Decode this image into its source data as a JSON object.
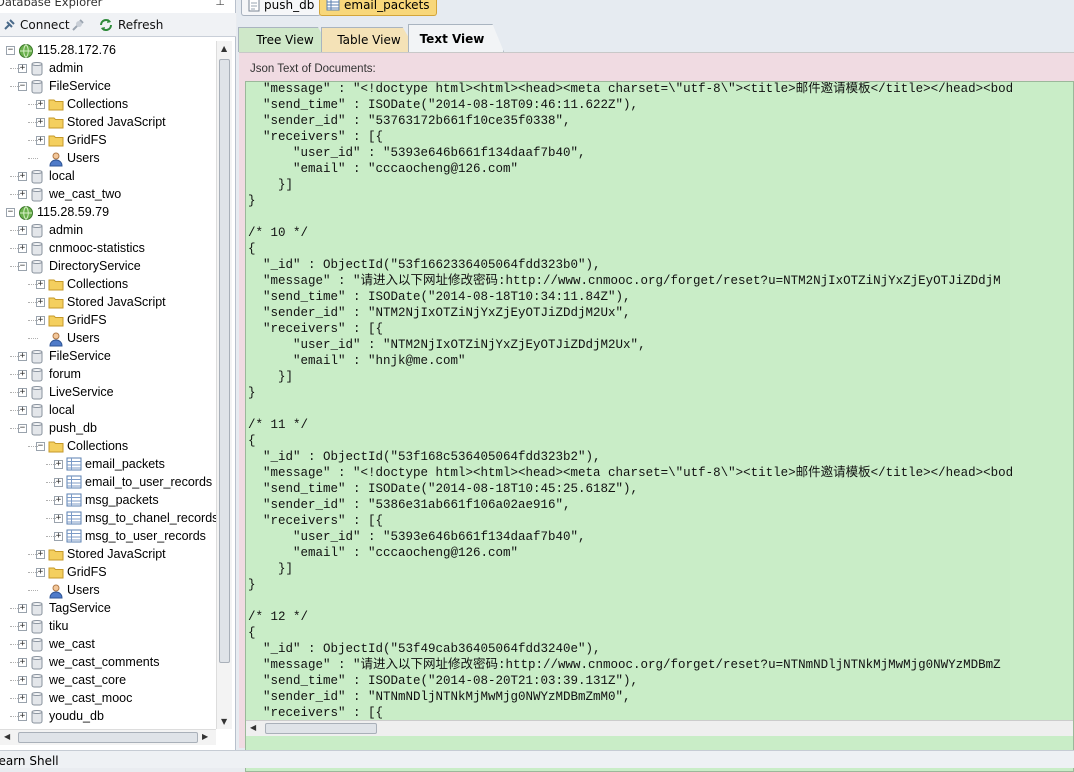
{
  "explorer": {
    "title": "Database Explorer",
    "pin": "⊥",
    "connect_label": "Connect",
    "refresh_label": "Refresh"
  },
  "tree": [
    {
      "label": "115.28.172.76",
      "icon": "server-icon",
      "level": 0,
      "exp": "-"
    },
    {
      "label": "admin",
      "icon": "database-icon",
      "level": 1,
      "exp": "+"
    },
    {
      "label": "FileService",
      "icon": "database-icon",
      "level": 1,
      "exp": "-"
    },
    {
      "label": "Collections",
      "icon": "folder-icon",
      "level": 2,
      "exp": "+"
    },
    {
      "label": "Stored JavaScript",
      "icon": "folder-icon",
      "level": 2,
      "exp": "+"
    },
    {
      "label": "GridFS",
      "icon": "folder-icon",
      "level": 2,
      "exp": "+"
    },
    {
      "label": "Users",
      "icon": "user-icon",
      "level": 2,
      "exp": ""
    },
    {
      "label": "local",
      "icon": "database-icon",
      "level": 1,
      "exp": "+"
    },
    {
      "label": "we_cast_two",
      "icon": "database-icon",
      "level": 1,
      "exp": "+"
    },
    {
      "label": "115.28.59.79",
      "icon": "server-icon",
      "level": 0,
      "exp": "-"
    },
    {
      "label": "admin",
      "icon": "database-icon",
      "level": 1,
      "exp": "+"
    },
    {
      "label": "cnmooc-statistics",
      "icon": "database-icon",
      "level": 1,
      "exp": "+"
    },
    {
      "label": "DirectoryService",
      "icon": "database-icon",
      "level": 1,
      "exp": "-"
    },
    {
      "label": "Collections",
      "icon": "folder-icon",
      "level": 2,
      "exp": "+"
    },
    {
      "label": "Stored JavaScript",
      "icon": "folder-icon",
      "level": 2,
      "exp": "+"
    },
    {
      "label": "GridFS",
      "icon": "folder-icon",
      "level": 2,
      "exp": "+"
    },
    {
      "label": "Users",
      "icon": "user-icon",
      "level": 2,
      "exp": ""
    },
    {
      "label": "FileService",
      "icon": "database-icon",
      "level": 1,
      "exp": "+"
    },
    {
      "label": "forum",
      "icon": "database-icon",
      "level": 1,
      "exp": "+"
    },
    {
      "label": "LiveService",
      "icon": "database-icon",
      "level": 1,
      "exp": "+"
    },
    {
      "label": "local",
      "icon": "database-icon",
      "level": 1,
      "exp": "+"
    },
    {
      "label": "push_db",
      "icon": "database-icon",
      "level": 1,
      "exp": "-"
    },
    {
      "label": "Collections",
      "icon": "folder-icon",
      "level": 2,
      "exp": "-"
    },
    {
      "label": "email_packets",
      "icon": "table-icon",
      "level": 3,
      "exp": "+"
    },
    {
      "label": "email_to_user_records",
      "icon": "table-icon",
      "level": 3,
      "exp": "+"
    },
    {
      "label": "msg_packets",
      "icon": "table-icon",
      "level": 3,
      "exp": "+"
    },
    {
      "label": "msg_to_chanel_records",
      "icon": "table-icon",
      "level": 3,
      "exp": "+"
    },
    {
      "label": "msg_to_user_records",
      "icon": "table-icon",
      "level": 3,
      "exp": "+"
    },
    {
      "label": "Stored JavaScript",
      "icon": "folder-icon",
      "level": 2,
      "exp": "+"
    },
    {
      "label": "GridFS",
      "icon": "folder-icon",
      "level": 2,
      "exp": "+"
    },
    {
      "label": "Users",
      "icon": "user-icon",
      "level": 2,
      "exp": ""
    },
    {
      "label": "TagService",
      "icon": "database-icon",
      "level": 1,
      "exp": "+"
    },
    {
      "label": "tiku",
      "icon": "database-icon",
      "level": 1,
      "exp": "+"
    },
    {
      "label": "we_cast",
      "icon": "database-icon",
      "level": 1,
      "exp": "+"
    },
    {
      "label": "we_cast_comments",
      "icon": "database-icon",
      "level": 1,
      "exp": "+"
    },
    {
      "label": "we_cast_core",
      "icon": "database-icon",
      "level": 1,
      "exp": "+"
    },
    {
      "label": "we_cast_mooc",
      "icon": "database-icon",
      "level": 1,
      "exp": "+"
    },
    {
      "label": "youdu_db",
      "icon": "database-icon",
      "level": 1,
      "exp": "+"
    }
  ],
  "doc_tabs": [
    {
      "label": "push_db",
      "icon": "document-icon",
      "active": false
    },
    {
      "label": "email_packets",
      "icon": "table-icon",
      "active": true
    }
  ],
  "view_tabs": {
    "tree": "Tree View",
    "table": "Table View",
    "text": "Text View"
  },
  "pane_label": "Json Text of Documents:",
  "code_lines": [
    "  \"message\" : \"<!doctype html><html><head><meta charset=\\\"utf-8\\\"><title>邮件邀请模板</title></head><bod",
    "  \"send_time\" : ISODate(\"2014-08-18T09:46:11.622Z\"),",
    "  \"sender_id\" : \"53763172b661f10ce35f0338\",",
    "  \"receivers\" : [{",
    "      \"user_id\" : \"5393e646b661f134daaf7b40\",",
    "      \"email\" : \"cccaocheng@126.com\"",
    "    }]",
    "}",
    "",
    "/* 10 */",
    "{",
    "  \"_id\" : ObjectId(\"53f1662336405064fdd323b0\"),",
    "  \"message\" : \"请进入以下网址修改密码:http://www.cnmooc.org/forget/reset?u=NTM2NjIxOTZiNjYxZjEyOTJiZDdjM",
    "  \"send_time\" : ISODate(\"2014-08-18T10:34:11.84Z\"),",
    "  \"sender_id\" : \"NTM2NjIxOTZiNjYxZjEyOTJiZDdjM2Ux\",",
    "  \"receivers\" : [{",
    "      \"user_id\" : \"NTM2NjIxOTZiNjYxZjEyOTJiZDdjM2Ux\",",
    "      \"email\" : \"hnjk@me.com\"",
    "    }]",
    "}",
    "",
    "/* 11 */",
    "{",
    "  \"_id\" : ObjectId(\"53f168c536405064fdd323b2\"),",
    "  \"message\" : \"<!doctype html><html><head><meta charset=\\\"utf-8\\\"><title>邮件邀请模板</title></head><bod",
    "  \"send_time\" : ISODate(\"2014-08-18T10:45:25.618Z\"),",
    "  \"sender_id\" : \"5386e31ab661f106a02ae916\",",
    "  \"receivers\" : [{",
    "      \"user_id\" : \"5393e646b661f134daaf7b40\",",
    "      \"email\" : \"cccaocheng@126.com\"",
    "    }]",
    "}",
    "",
    "/* 12 */",
    "{",
    "  \"_id\" : ObjectId(\"53f49cab36405064fdd3240e\"),",
    "  \"message\" : \"请进入以下网址修改密码:http://www.cnmooc.org/forget/reset?u=NTNmNDljNTNkMjMwMjg0NWYzMDBmZ",
    "  \"send_time\" : ISODate(\"2014-08-20T21:03:39.131Z\"),",
    "  \"sender_id\" : \"NTNmNDljNTNkMjMwMjg0NWYzMDBmZmM0\",",
    "  \"receivers\" : [{"
  ],
  "status_bar": "Learn Shell"
}
